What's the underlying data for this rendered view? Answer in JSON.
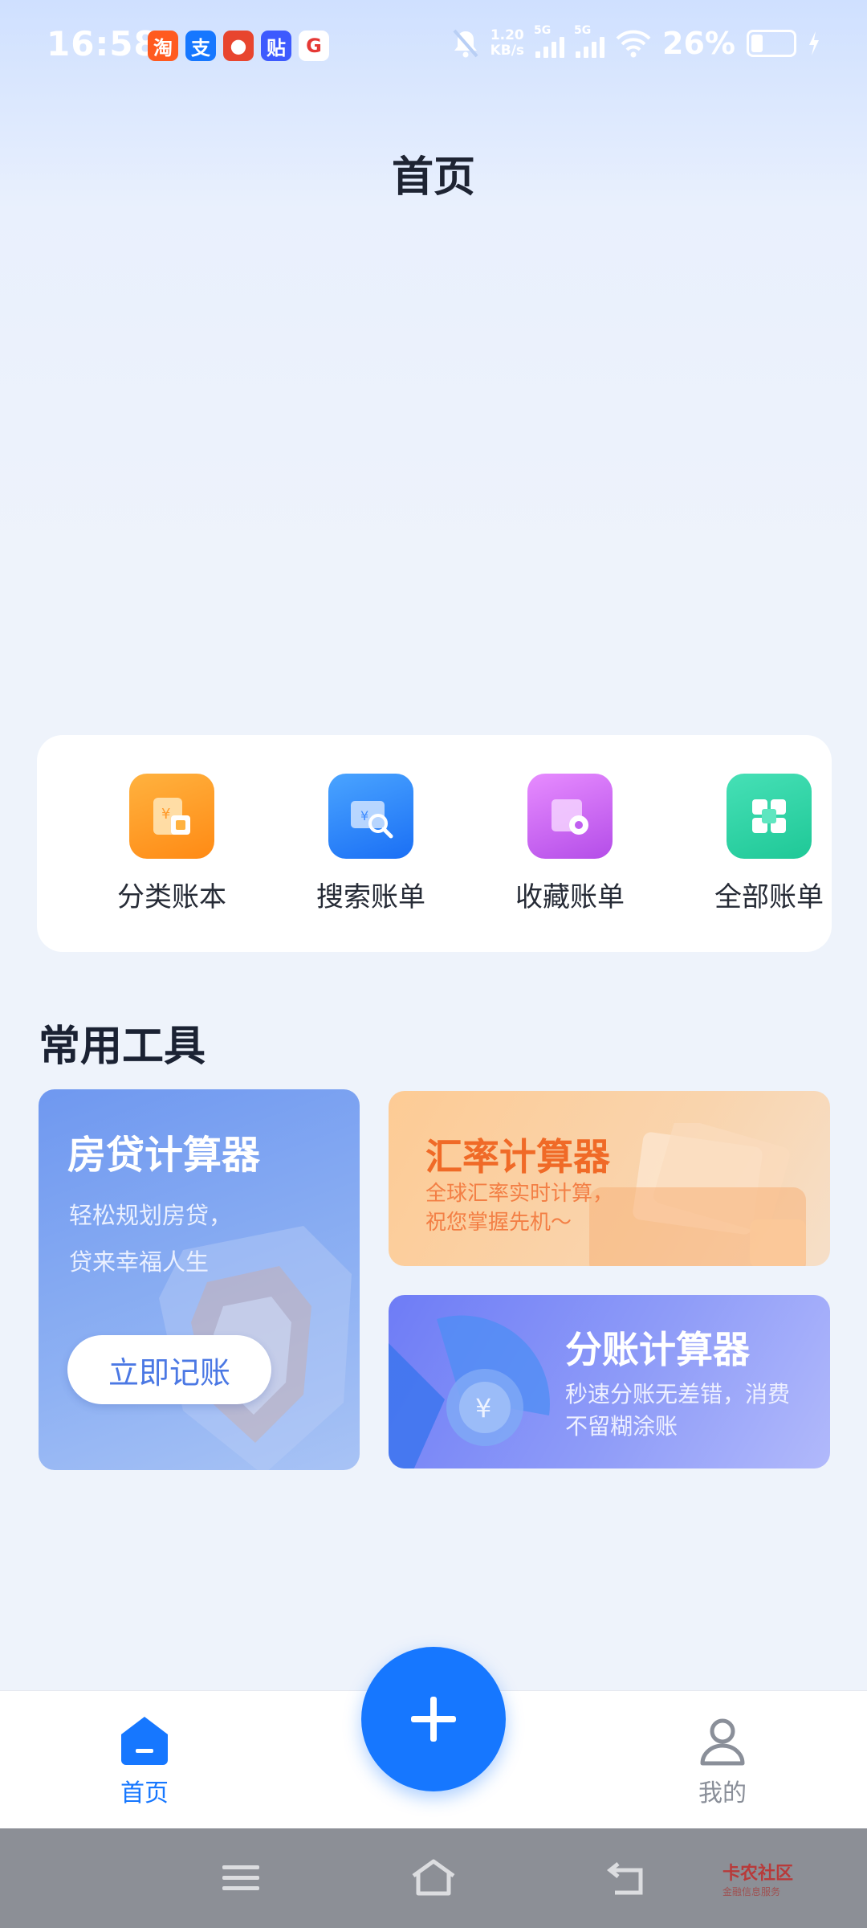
{
  "status_bar": {
    "time": "16:58",
    "notification_apps": [
      {
        "icon": "taobao-app-icon",
        "glyph": "淘",
        "color": "#ff5a1f"
      },
      {
        "icon": "alipay-app-icon",
        "glyph": "支",
        "color": "#1677ff"
      },
      {
        "icon": "red-app-icon",
        "glyph": "●",
        "color": "#e8452e"
      },
      {
        "icon": "tieba-app-icon",
        "glyph": "贴",
        "color": "#3d5afe"
      },
      {
        "icon": "shield-app-icon",
        "glyph": "G",
        "color": "#e53935"
      }
    ],
    "net_speed_value": "1.20",
    "net_speed_unit": "KB/s",
    "sim1_label": "5G",
    "sim2_label": "5G",
    "battery_pct": "26%",
    "battery_level": 0.26
  },
  "header": {
    "title": "首页"
  },
  "quick_entries": [
    {
      "label": "分类账本",
      "icon": "category-ledger-icon",
      "color_from": "#ffb23f",
      "color_to": "#ff8a14"
    },
    {
      "label": "搜索账单",
      "icon": "search-bill-icon",
      "color_from": "#4aa4ff",
      "color_to": "#1a6ff5"
    },
    {
      "label": "收藏账单",
      "icon": "favorite-bill-icon",
      "color_from": "#e78cff",
      "color_to": "#b44de8"
    },
    {
      "label": "全部账单",
      "icon": "all-bills-icon",
      "color_from": "#46e0b6",
      "color_to": "#1fc897"
    }
  ],
  "tools": {
    "section_title": "常用工具",
    "mortgage": {
      "title": "房贷计算器",
      "desc_line1": "轻松规划房贷，",
      "desc_line2": "贷来幸福人生",
      "button_label": "立即记账"
    },
    "exchange": {
      "title": "汇率计算器",
      "desc_line1": "全球汇率实时计算，",
      "desc_line2": "祝您掌握先机～"
    },
    "split": {
      "title": "分账计算器",
      "desc": "秒速分账无差错，消费不留糊涂账"
    }
  },
  "bottom_nav": {
    "home_label": "首页",
    "mine_label": "我的",
    "active_color": "#1677ff",
    "inactive_color": "#8a8f99"
  },
  "watermark": {
    "text": "卡农社区",
    "sub": "金融信息服务"
  }
}
